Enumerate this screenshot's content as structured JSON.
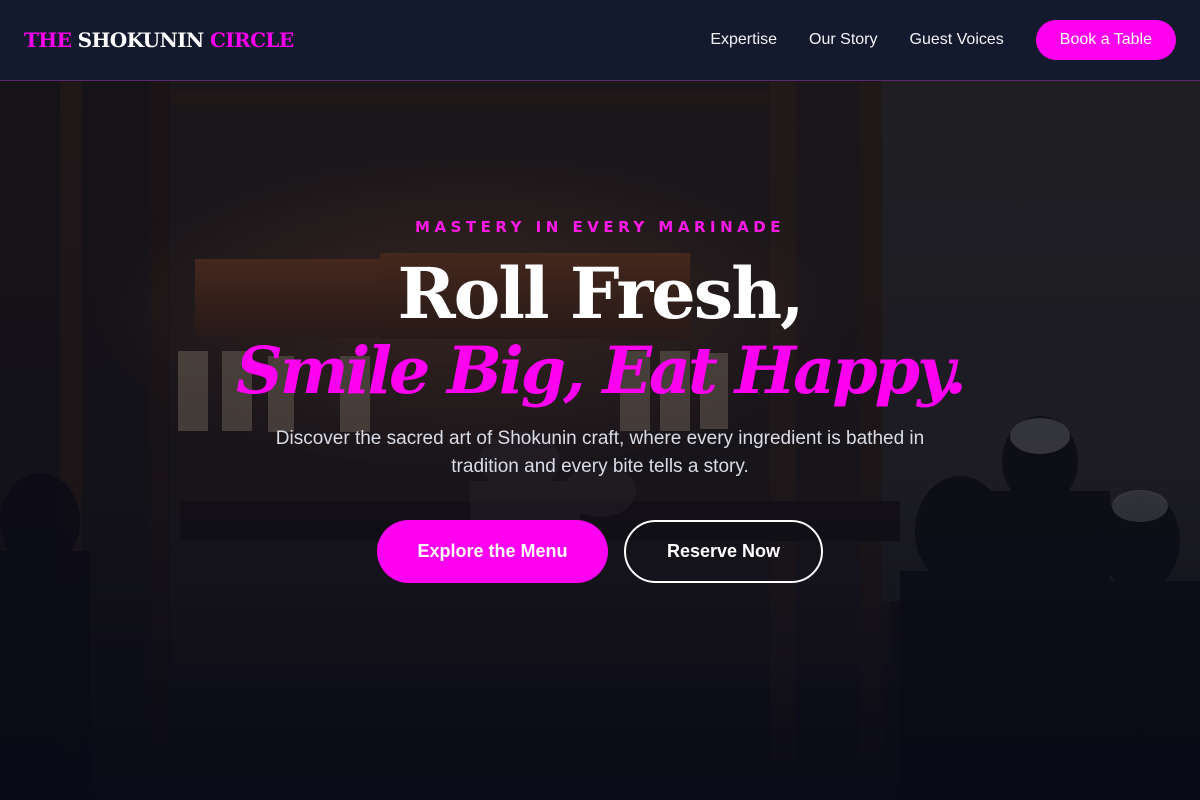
{
  "header": {
    "logo": {
      "part1": "THE",
      "part2": "SHOKUNIN",
      "part3": "CIRCLE"
    },
    "nav": [
      {
        "label": "Expertise"
      },
      {
        "label": "Our Story"
      },
      {
        "label": "Guest Voices"
      }
    ],
    "book_label": "Book a Table"
  },
  "hero": {
    "eyebrow": "MASTERY IN EVERY MARINADE",
    "headline_line1": "Roll Fresh,",
    "headline_line2": "Smile Big, Eat Happy.",
    "subtitle": "Discover the sacred art of Shokunin craft, where every ingredient is bathed in tradition and every bite tells a story.",
    "primary_cta": "Explore the Menu",
    "secondary_cta": "Reserve Now"
  },
  "colors": {
    "accent": "#ff00f0",
    "header_bg": "#141a2e",
    "page_bg": "#0b0d1c"
  },
  "background_image": "dim-restaurant-kitchen-photo"
}
